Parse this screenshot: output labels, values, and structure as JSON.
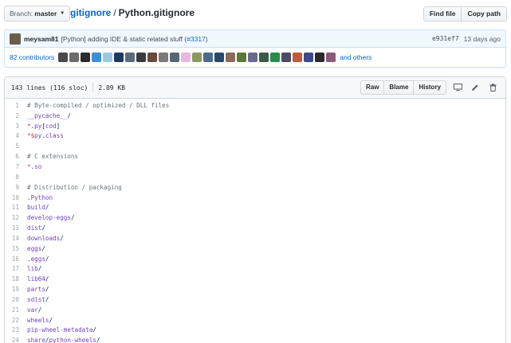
{
  "branch": {
    "label": "Branch:",
    "value": "master"
  },
  "breadcrumb": {
    "repo": "gitignore",
    "sep": "/",
    "file": "Python.gitignore"
  },
  "top_actions": {
    "find_file": "Find file",
    "copy_path": "Copy path"
  },
  "commit": {
    "author": "meysam81",
    "message_prefix": "[Python] adding IDE & static related stuff (",
    "pr": "#3317",
    "message_suffix": ")",
    "sha": "e931ef7",
    "time": "13 days ago"
  },
  "contributors": {
    "count": "82",
    "label": "contributors",
    "and_others": "and others",
    "avatar_colors": [
      "#4a4a4a",
      "#6b6b6b",
      "#2b2b2b",
      "#3a8fd8",
      "#9ecae1",
      "#1f3a5f",
      "#5a6b7c",
      "#3b3b3b",
      "#6a4a3a",
      "#7a7a7a",
      "#556677",
      "#e9b7e0",
      "#8a9a5b",
      "#4d6b8a",
      "#2a4a6a",
      "#8a6a5a",
      "#5a7a3a",
      "#6a6a8a",
      "#3a5a4a",
      "#2a8a4a",
      "#4a4a6a",
      "#c05a3a",
      "#3a4a8a",
      "#2a2a2a",
      "#8a5a7a"
    ]
  },
  "file": {
    "lines_info": "143 lines (116 sloc)",
    "size": "2.09 KB",
    "raw": "Raw",
    "blame": "Blame",
    "history": "History"
  },
  "code_lines": [
    {
      "n": "1",
      "t": "# Byte-compiled / optimized / DLL files"
    },
    {
      "n": "2",
      "t": "__pycache__/"
    },
    {
      "n": "3",
      "t": "*.py[cod]"
    },
    {
      "n": "4",
      "t": "*$py.class"
    },
    {
      "n": "5",
      "t": ""
    },
    {
      "n": "6",
      "t": "# C extensions"
    },
    {
      "n": "7",
      "t": "*.so"
    },
    {
      "n": "8",
      "t": ""
    },
    {
      "n": "9",
      "t": "# Distribution / packaging"
    },
    {
      "n": "10",
      "t": ".Python"
    },
    {
      "n": "11",
      "t": "build/"
    },
    {
      "n": "12",
      "t": "develop-eggs/"
    },
    {
      "n": "13",
      "t": "dist/"
    },
    {
      "n": "14",
      "t": "downloads/"
    },
    {
      "n": "15",
      "t": "eggs/"
    },
    {
      "n": "16",
      "t": ".eggs/"
    },
    {
      "n": "17",
      "t": "lib/"
    },
    {
      "n": "18",
      "t": "lib64/"
    },
    {
      "n": "19",
      "t": "parts/"
    },
    {
      "n": "20",
      "t": "sdist/"
    },
    {
      "n": "21",
      "t": "var/"
    },
    {
      "n": "22",
      "t": "wheels/"
    },
    {
      "n": "23",
      "t": "pip-wheel-metadata/"
    },
    {
      "n": "24",
      "t": "share/python-wheels/"
    }
  ]
}
